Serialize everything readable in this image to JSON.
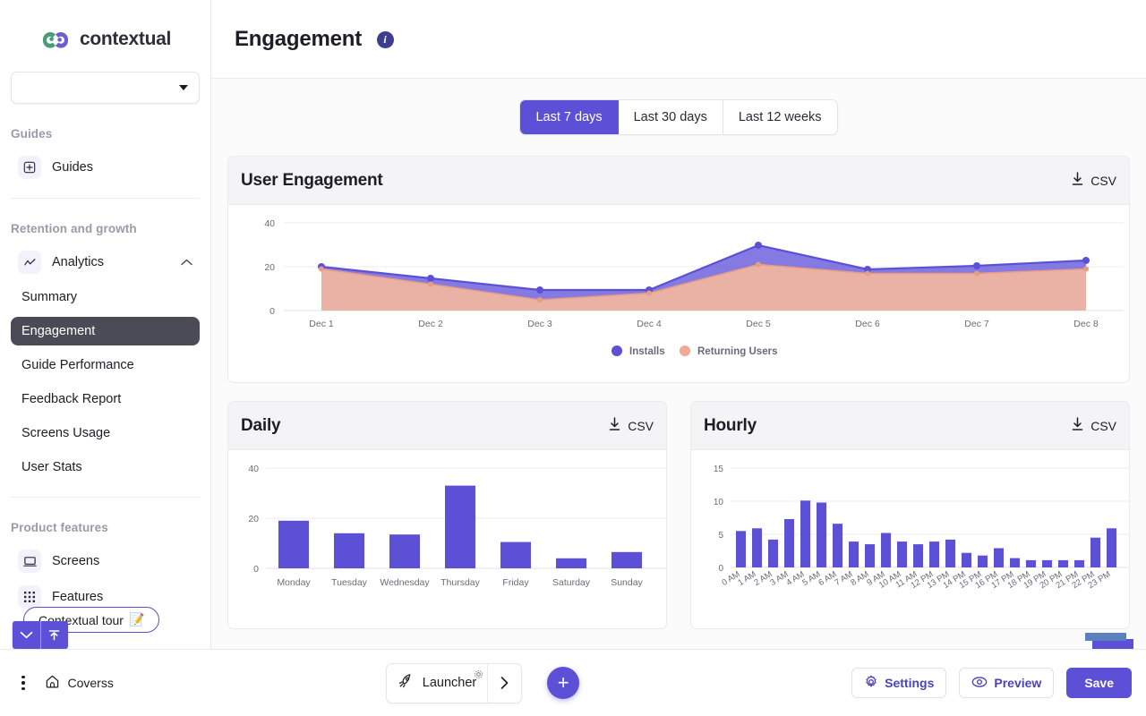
{
  "brand": {
    "name": "contextual",
    "logo_icon": "contextual-logo",
    "accent": "#5b50d6",
    "green": "#4a9c78",
    "purple": "#6b5fd0"
  },
  "sidebar": {
    "app_select": {
      "value": "",
      "placeholder": "",
      "icon": "chevron-down-icon"
    },
    "sections": [
      {
        "title": "Guides",
        "items": [
          {
            "label": "Guides",
            "icon": "guides-icon"
          }
        ]
      },
      {
        "title": "Retention and growth",
        "items": [
          {
            "label": "Analytics",
            "icon": "analytics-icon",
            "chevron": "chevron-up-icon",
            "expanded": true
          }
        ],
        "sub_items": [
          {
            "label": "Summary",
            "active": false
          },
          {
            "label": "Engagement",
            "active": true
          },
          {
            "label": "Guide Performance",
            "active": false
          },
          {
            "label": "Feedback Report",
            "active": false
          },
          {
            "label": "Screens Usage",
            "active": false
          },
          {
            "label": "User Stats",
            "active": false
          }
        ]
      },
      {
        "title": "Product features",
        "items": [
          {
            "label": "Screens",
            "icon": "screens-icon"
          },
          {
            "label": "Features",
            "icon": "features-grid-icon"
          }
        ]
      }
    ],
    "tour_pill": {
      "label": "Contextual tour",
      "emoji": "📝"
    },
    "tour_widget": {
      "collapse_icon": "chevron-down-icon",
      "dock_icon": "arrow-up-to-line-icon"
    }
  },
  "header": {
    "title": "Engagement",
    "info_icon": "info-icon",
    "info_glyph": "i"
  },
  "range_tabs": [
    {
      "label": "Last 7 days",
      "active": true
    },
    {
      "label": "Last 30 days",
      "active": false
    },
    {
      "label": "Last 12 weeks",
      "active": false
    }
  ],
  "cards": {
    "engagement": {
      "title": "User Engagement",
      "csv_label": "CSV",
      "csv_icon": "download-icon"
    },
    "daily": {
      "title": "Daily",
      "csv_label": "CSV",
      "csv_icon": "download-icon"
    },
    "hourly": {
      "title": "Hourly",
      "csv_label": "CSV",
      "csv_icon": "download-icon"
    }
  },
  "chart_data": [
    {
      "type": "area",
      "id": "user-engagement",
      "title": "User Engagement",
      "x": [
        "Dec 1",
        "Dec 2",
        "Dec 3",
        "Dec 4",
        "Dec 5",
        "Dec 6",
        "Dec 7",
        "Dec 8"
      ],
      "series": [
        {
          "name": "Installs",
          "color": "#5b50d6",
          "values": [
            20,
            15,
            9.5,
            9.5,
            30,
            19,
            20.5,
            23
          ]
        },
        {
          "name": "Returning Users",
          "color": "#eca68f",
          "values": [
            19,
            12,
            5,
            8,
            21,
            17,
            17,
            19
          ]
        }
      ],
      "ylim": [
        0,
        40
      ],
      "yticks": [
        0,
        20,
        40
      ],
      "grid": true,
      "legend": "bottom-center",
      "xlabel": "",
      "ylabel": ""
    },
    {
      "type": "bar",
      "id": "daily",
      "title": "Daily",
      "categories": [
        "Monday",
        "Tuesday",
        "Wednesday",
        "Thursday",
        "Friday",
        "Saturday",
        "Sunday"
      ],
      "values": [
        19,
        14,
        13.5,
        33,
        10.5,
        4,
        6.5
      ],
      "color": "#5b50d6",
      "ylim": [
        0,
        40
      ],
      "yticks": [
        0,
        20,
        40
      ],
      "grid": true,
      "xlabel": "",
      "ylabel": ""
    },
    {
      "type": "bar",
      "id": "hourly",
      "title": "Hourly",
      "categories": [
        "0 AM",
        "1 AM",
        "2 AM",
        "3 AM",
        "4 AM",
        "5 AM",
        "6 AM",
        "7 AM",
        "8 AM",
        "9 AM",
        "10 AM",
        "11 AM",
        "12 PM",
        "13 PM",
        "14 PM",
        "15 PM",
        "16 PM",
        "17 PM",
        "18 PM",
        "19 PM",
        "20 PM",
        "21 PM",
        "22 PM",
        "23 PM"
      ],
      "values": [
        5.5,
        5.9,
        4.2,
        7.3,
        10.1,
        9.8,
        6.6,
        3.9,
        3.5,
        5.2,
        3.9,
        3.5,
        3.9,
        4.2,
        2.2,
        1.8,
        2.9,
        1.4,
        1.1,
        1.1,
        1.1,
        1.1,
        4.5,
        5.9
      ],
      "color": "#5b50d6",
      "ylim": [
        0,
        15
      ],
      "yticks": [
        0,
        5,
        10,
        15
      ],
      "grid": true,
      "xlabel": "",
      "ylabel": ""
    }
  ],
  "bottom_bar": {
    "menu_icon": "kebab-menu-icon",
    "home_icon": "home-icon",
    "breadcrumb": "Coverss",
    "launcher": {
      "label": "Launcher",
      "icon": "rocket-icon",
      "gear_icon": "gear-icon",
      "arrow_icon": "chevron-right-icon"
    },
    "add_button": {
      "icon": "plus-icon",
      "glyph": "+"
    },
    "settings": {
      "label": "Settings",
      "icon": "gear-icon"
    },
    "preview": {
      "label": "Preview",
      "icon": "eye-icon"
    },
    "save": {
      "label": "Save"
    }
  }
}
